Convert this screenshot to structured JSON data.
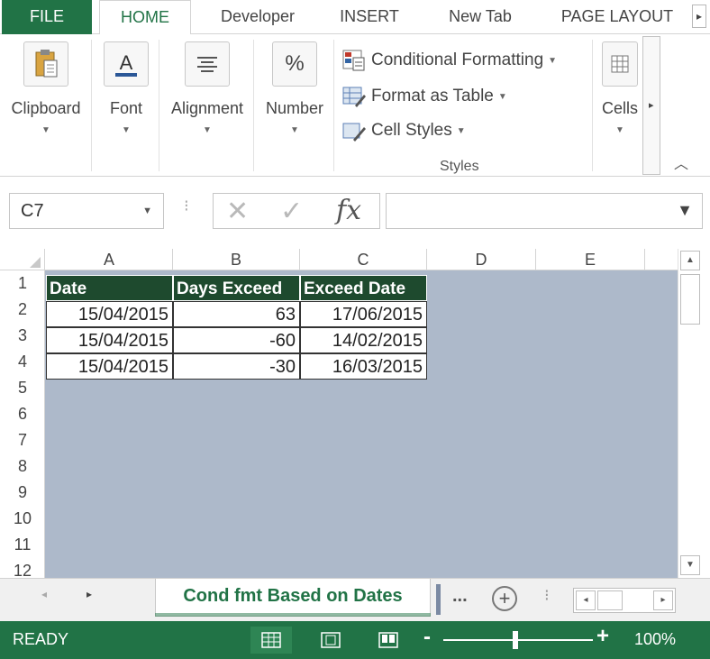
{
  "ribbon_tabs": [
    "FILE",
    "HOME",
    "Developer",
    "INSERT",
    "New Tab",
    "PAGE LAYOUT"
  ],
  "ribbon": {
    "groups": {
      "clipboard": "Clipboard",
      "font": "Font",
      "alignment": "Alignment",
      "number": "Number",
      "cells": "Cells",
      "styles_label": "Styles"
    },
    "styles_items": {
      "conditional": "Conditional Formatting",
      "format_table": "Format as Table",
      "cell_styles": "Cell Styles"
    }
  },
  "formula_bar": {
    "name_box": "C7",
    "fx": "fx",
    "formula": ""
  },
  "sheet": {
    "columns": [
      "A",
      "B",
      "C",
      "D",
      "E"
    ],
    "rows": [
      "1",
      "2",
      "3",
      "4",
      "5",
      "6",
      "7",
      "8",
      "9",
      "10",
      "11",
      "12"
    ],
    "headers": [
      "Date",
      "Days Exceed",
      "Exceed Date"
    ],
    "data": [
      [
        "15/04/2015",
        "63",
        "17/06/2015"
      ],
      [
        "15/04/2015",
        "-60",
        "14/02/2015"
      ],
      [
        "15/04/2015",
        "-30",
        "16/03/2015"
      ]
    ],
    "fill_color": "#adb9ca",
    "header_fill": "#1e4a2e"
  },
  "sheet_tabs": {
    "active": "Cond fmt Based on Dates",
    "more": "..."
  },
  "status_bar": {
    "ready": "READY",
    "zoom": "100%",
    "accent": "#217346"
  }
}
